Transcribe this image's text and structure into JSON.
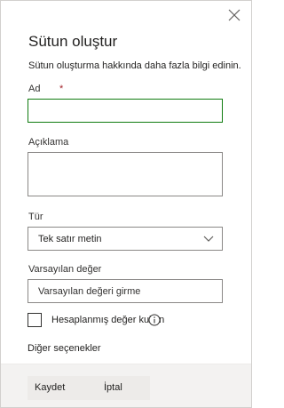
{
  "panel": {
    "title": "Sütun oluştur",
    "help_link": "Sütun oluşturma hakkında daha fazla bilgi edinin."
  },
  "fields": {
    "name_label": "Ad",
    "required_mark": "*",
    "description_label": "Açıklama",
    "type_label": "Tür",
    "type_value": "Tek satır metin",
    "default_label": "Varsayılan değer",
    "default_placeholder": "Varsayılan değeri girme",
    "calculated_label": "Hesaplanmış değer kullan"
  },
  "more_options": "Diğer seçenekler",
  "footer": {
    "save_label": "Kaydet",
    "cancel_label": "İptal"
  },
  "icons": {
    "close": "close-icon",
    "dropdown": "chevron-down-icon",
    "info": "info-icon"
  },
  "colors": {
    "focus_border": "#107c10",
    "required": "#a4262c",
    "footer_bg": "#f3f2f1"
  }
}
